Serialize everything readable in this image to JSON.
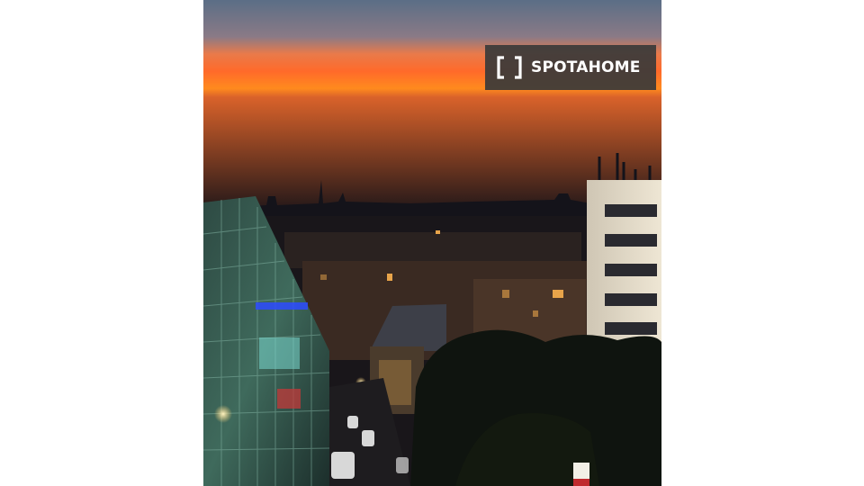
{
  "image": {
    "description_name": "berlin-sunset-city-view"
  },
  "watermark": {
    "brand": "SPOTAHOME",
    "icon": "bracket-logo-icon"
  },
  "colors": {
    "sky_top": "#5b6e86",
    "sky_mid": "#ff6a2a",
    "sky_horizon": "#ff8a1e",
    "watermark_bg": "#3a3a3a"
  }
}
